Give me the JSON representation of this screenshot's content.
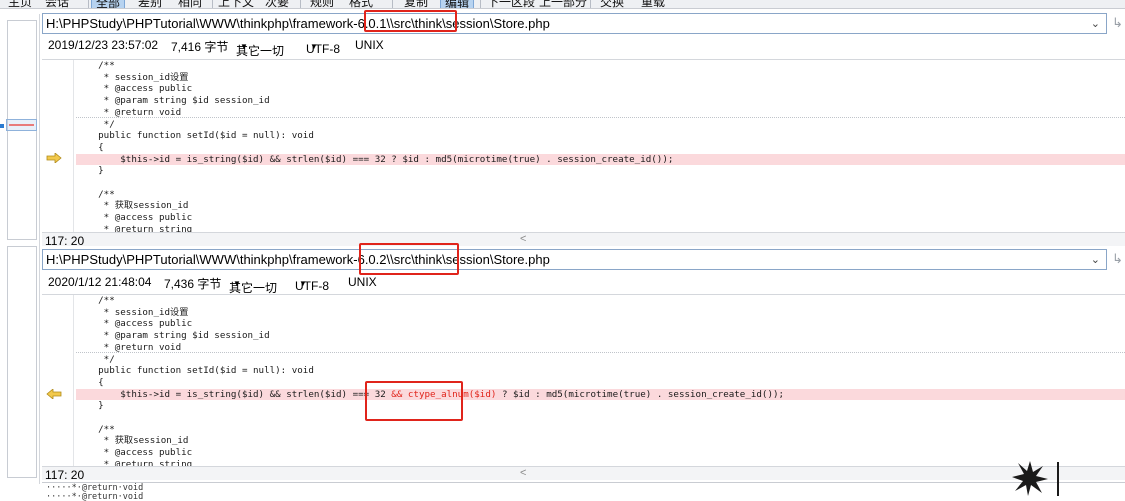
{
  "toolbar": {
    "items": [
      "主页",
      "会话",
      "全部",
      "差别",
      "相同",
      "上下文",
      "次要",
      "规则",
      "格式",
      "复制",
      "编辑",
      "下一区段",
      "上一部分",
      "交换",
      "重载"
    ]
  },
  "top_pane": {
    "path_prefix": "H:\\PHPStudy\\PHPTutorial\\WWW\\thinkphp\\framework-6.0.1\\",
    "path_highlight": "framework-6.0.1",
    "path_suffix": "\\src\\think\\session\\Store.php",
    "date": "2019/12/23 23:57:02",
    "size": "7,416 字节",
    "other": "其它一切",
    "encoding": "UTF-8",
    "line_ending": "UNIX",
    "cursor_pos": "117: 20",
    "code": [
      "    /**",
      "     * session_id设置",
      "     * @access public",
      "     * @param string $id session_id",
      "     * @return void",
      "     */",
      "    public function setId($id = null): void",
      "    {",
      "        $this->id = is_string($id) && strlen($id) === 32 ? $id : md5(microtime(true) . session_create_id());",
      "    }",
      "",
      "    /**",
      "     * 获取session_id",
      "     * @access public",
      "     * @return string"
    ]
  },
  "bottom_pane": {
    "path_prefix": "H:\\PHPStudy\\PHPTutorial\\WWW\\thinkphp\\framework-6.0.2\\",
    "path_highlight": "framework-6.0.2",
    "path_suffix": "\\src\\think\\session\\Store.php",
    "date": "2020/1/12 21:48:04",
    "size": "7,436 字节",
    "other": "其它一切",
    "encoding": "UTF-8",
    "line_ending": "UNIX",
    "cursor_pos": "117: 20",
    "code": [
      "    /**",
      "     * session_id设置",
      "     * @access public",
      "     * @param string $id session_id",
      "     * @return void",
      "     */",
      "    public function setId($id = null): void",
      "    {",
      "",
      "    }",
      "",
      "    /**",
      "     * 获取session_id",
      "     * @access public",
      "     * @return string"
    ],
    "diff_line_pre": "        $this->id = is_string($id) && strlen($id) === 32 ",
    "diff_line_chg": "&& ctype_alnum($id)",
    "diff_line_post": " ? $id : md5(microtime(true) . session_create_id());"
  },
  "bottom_strip": {
    "line1": "·····*·@return·void",
    "line2": "·····*·@return·void"
  },
  "colors": {
    "diff_bg": "#fbd9dc",
    "highlight_red": "#e0241b",
    "arrow_yellow": "#f2c94c"
  }
}
